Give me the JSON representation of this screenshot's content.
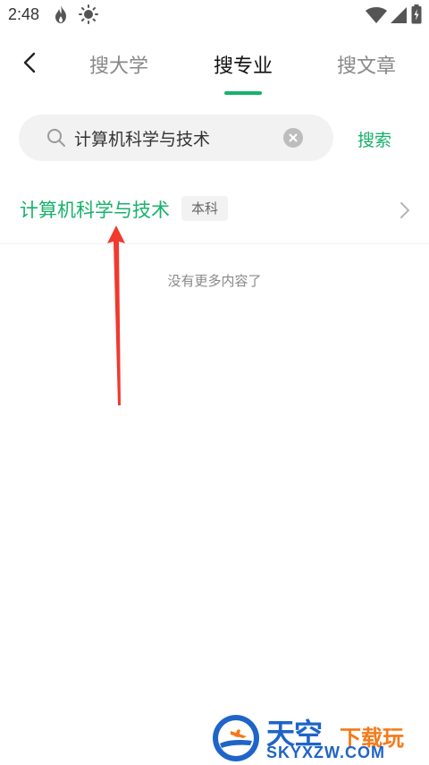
{
  "status_bar": {
    "time": "2:48",
    "left_icons": [
      "flame-icon",
      "brightness-icon"
    ],
    "right_icons": [
      "wifi-icon",
      "cellular-signal-icon",
      "battery-icon"
    ]
  },
  "nav": {
    "back_icon": "chevron-left-icon",
    "tabs": [
      {
        "label": "搜大学",
        "active": false
      },
      {
        "label": "搜专业",
        "active": true
      },
      {
        "label": "搜文章",
        "active": false
      }
    ]
  },
  "search": {
    "value": "计算机科学与技术",
    "placeholder": "",
    "button_label": "搜索"
  },
  "results": [
    {
      "name": "计算机科学与技术",
      "badge": "本科"
    }
  ],
  "end_message": "没有更多内容了",
  "watermark": {
    "title": "天空",
    "subtitle": "下载玩",
    "url": "SKYXZW.COM"
  },
  "colors": {
    "accent": "#17b26a",
    "annotation": "#f03a2e",
    "watermark_blue": "#1f64c8",
    "watermark_orange": "#f47a1a"
  }
}
